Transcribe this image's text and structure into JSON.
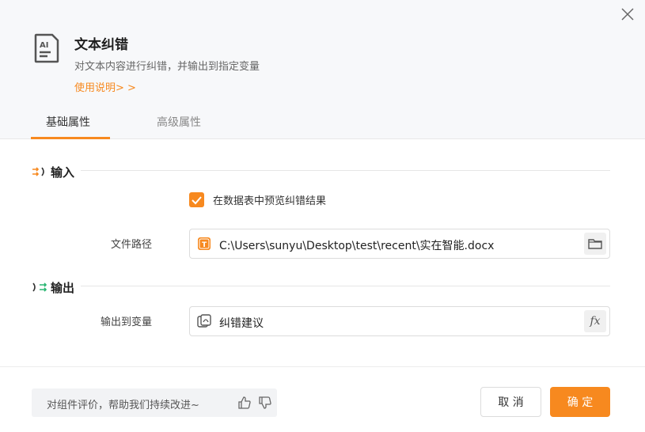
{
  "dialog": {
    "title": "文本纠错",
    "description": "对文本内容进行纠错，并输出到指定变量",
    "help_link": "使用说明> >"
  },
  "tabs": [
    {
      "label": "基础属性",
      "active": true
    },
    {
      "label": "高级属性",
      "active": false
    }
  ],
  "input_section": {
    "title": "输入",
    "preview_checkbox": {
      "label": "在数据表中预览纠错结果",
      "checked": true
    },
    "file_path": {
      "label": "文件路径",
      "value": "C:\\Users\\sunyu\\Desktop\\test\\recent\\实在智能.docx"
    }
  },
  "output_section": {
    "title": "输出",
    "output_variable": {
      "label": "输出到变量",
      "value": "纠错建议",
      "fx_label": "fx"
    }
  },
  "footer": {
    "feedback_text": "对组件评价，帮助我们持续改进~",
    "cancel_label": "取 消",
    "ok_label": "确 定"
  },
  "colors": {
    "accent": "#f7891f",
    "header_bg": "#f7f8fa",
    "output_icon": "#2bb673"
  }
}
